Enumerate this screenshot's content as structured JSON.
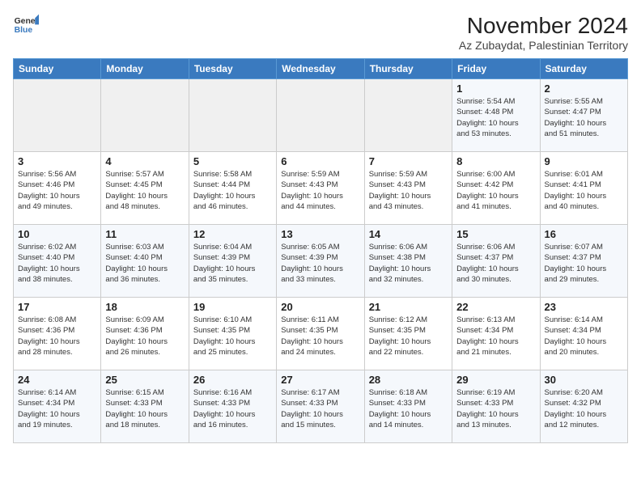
{
  "logo": {
    "line1": "General",
    "line2": "Blue"
  },
  "title": "November 2024",
  "subtitle": "Az Zubaydat, Palestinian Territory",
  "weekdays": [
    "Sunday",
    "Monday",
    "Tuesday",
    "Wednesday",
    "Thursday",
    "Friday",
    "Saturday"
  ],
  "weeks": [
    [
      {
        "day": "",
        "info": ""
      },
      {
        "day": "",
        "info": ""
      },
      {
        "day": "",
        "info": ""
      },
      {
        "day": "",
        "info": ""
      },
      {
        "day": "",
        "info": ""
      },
      {
        "day": "1",
        "info": "Sunrise: 5:54 AM\nSunset: 4:48 PM\nDaylight: 10 hours\nand 53 minutes."
      },
      {
        "day": "2",
        "info": "Sunrise: 5:55 AM\nSunset: 4:47 PM\nDaylight: 10 hours\nand 51 minutes."
      }
    ],
    [
      {
        "day": "3",
        "info": "Sunrise: 5:56 AM\nSunset: 4:46 PM\nDaylight: 10 hours\nand 49 minutes."
      },
      {
        "day": "4",
        "info": "Sunrise: 5:57 AM\nSunset: 4:45 PM\nDaylight: 10 hours\nand 48 minutes."
      },
      {
        "day": "5",
        "info": "Sunrise: 5:58 AM\nSunset: 4:44 PM\nDaylight: 10 hours\nand 46 minutes."
      },
      {
        "day": "6",
        "info": "Sunrise: 5:59 AM\nSunset: 4:43 PM\nDaylight: 10 hours\nand 44 minutes."
      },
      {
        "day": "7",
        "info": "Sunrise: 5:59 AM\nSunset: 4:43 PM\nDaylight: 10 hours\nand 43 minutes."
      },
      {
        "day": "8",
        "info": "Sunrise: 6:00 AM\nSunset: 4:42 PM\nDaylight: 10 hours\nand 41 minutes."
      },
      {
        "day": "9",
        "info": "Sunrise: 6:01 AM\nSunset: 4:41 PM\nDaylight: 10 hours\nand 40 minutes."
      }
    ],
    [
      {
        "day": "10",
        "info": "Sunrise: 6:02 AM\nSunset: 4:40 PM\nDaylight: 10 hours\nand 38 minutes."
      },
      {
        "day": "11",
        "info": "Sunrise: 6:03 AM\nSunset: 4:40 PM\nDaylight: 10 hours\nand 36 minutes."
      },
      {
        "day": "12",
        "info": "Sunrise: 6:04 AM\nSunset: 4:39 PM\nDaylight: 10 hours\nand 35 minutes."
      },
      {
        "day": "13",
        "info": "Sunrise: 6:05 AM\nSunset: 4:39 PM\nDaylight: 10 hours\nand 33 minutes."
      },
      {
        "day": "14",
        "info": "Sunrise: 6:06 AM\nSunset: 4:38 PM\nDaylight: 10 hours\nand 32 minutes."
      },
      {
        "day": "15",
        "info": "Sunrise: 6:06 AM\nSunset: 4:37 PM\nDaylight: 10 hours\nand 30 minutes."
      },
      {
        "day": "16",
        "info": "Sunrise: 6:07 AM\nSunset: 4:37 PM\nDaylight: 10 hours\nand 29 minutes."
      }
    ],
    [
      {
        "day": "17",
        "info": "Sunrise: 6:08 AM\nSunset: 4:36 PM\nDaylight: 10 hours\nand 28 minutes."
      },
      {
        "day": "18",
        "info": "Sunrise: 6:09 AM\nSunset: 4:36 PM\nDaylight: 10 hours\nand 26 minutes."
      },
      {
        "day": "19",
        "info": "Sunrise: 6:10 AM\nSunset: 4:35 PM\nDaylight: 10 hours\nand 25 minutes."
      },
      {
        "day": "20",
        "info": "Sunrise: 6:11 AM\nSunset: 4:35 PM\nDaylight: 10 hours\nand 24 minutes."
      },
      {
        "day": "21",
        "info": "Sunrise: 6:12 AM\nSunset: 4:35 PM\nDaylight: 10 hours\nand 22 minutes."
      },
      {
        "day": "22",
        "info": "Sunrise: 6:13 AM\nSunset: 4:34 PM\nDaylight: 10 hours\nand 21 minutes."
      },
      {
        "day": "23",
        "info": "Sunrise: 6:14 AM\nSunset: 4:34 PM\nDaylight: 10 hours\nand 20 minutes."
      }
    ],
    [
      {
        "day": "24",
        "info": "Sunrise: 6:14 AM\nSunset: 4:34 PM\nDaylight: 10 hours\nand 19 minutes."
      },
      {
        "day": "25",
        "info": "Sunrise: 6:15 AM\nSunset: 4:33 PM\nDaylight: 10 hours\nand 18 minutes."
      },
      {
        "day": "26",
        "info": "Sunrise: 6:16 AM\nSunset: 4:33 PM\nDaylight: 10 hours\nand 16 minutes."
      },
      {
        "day": "27",
        "info": "Sunrise: 6:17 AM\nSunset: 4:33 PM\nDaylight: 10 hours\nand 15 minutes."
      },
      {
        "day": "28",
        "info": "Sunrise: 6:18 AM\nSunset: 4:33 PM\nDaylight: 10 hours\nand 14 minutes."
      },
      {
        "day": "29",
        "info": "Sunrise: 6:19 AM\nSunset: 4:33 PM\nDaylight: 10 hours\nand 13 minutes."
      },
      {
        "day": "30",
        "info": "Sunrise: 6:20 AM\nSunset: 4:32 PM\nDaylight: 10 hours\nand 12 minutes."
      }
    ]
  ]
}
